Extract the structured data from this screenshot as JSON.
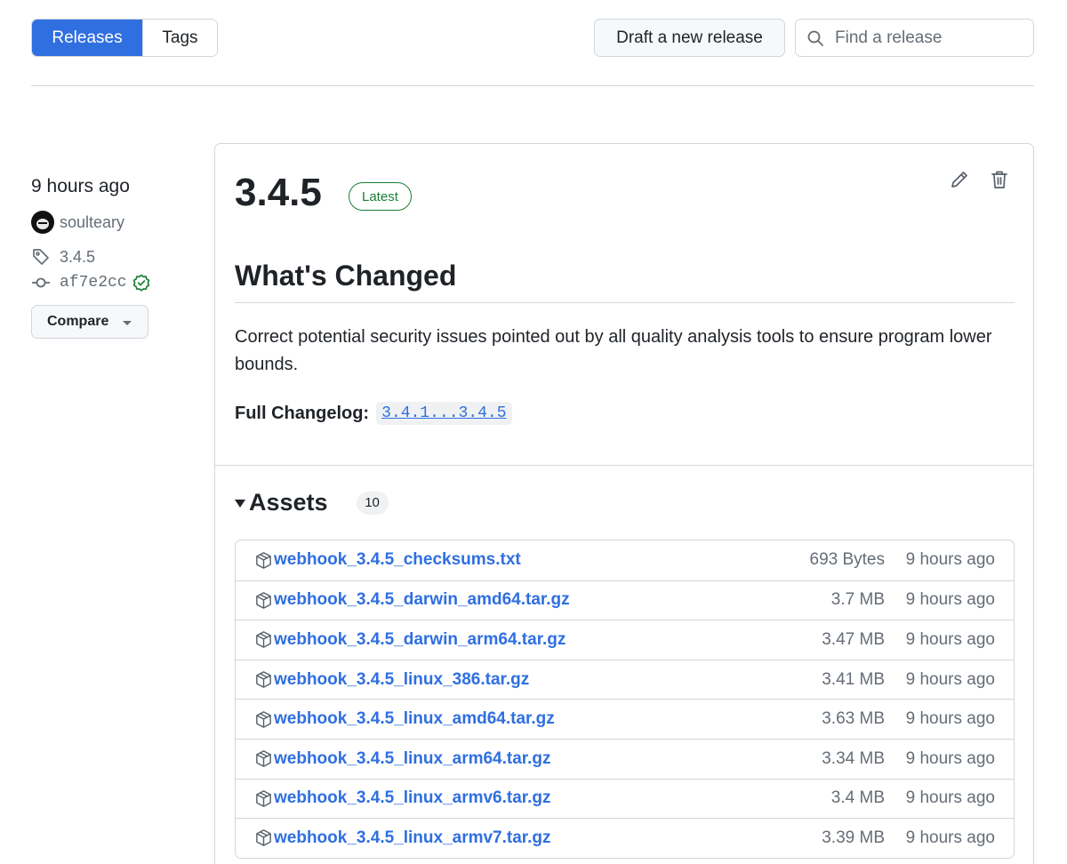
{
  "tabs": {
    "releases": "Releases",
    "tags": "Tags"
  },
  "actions": {
    "draft": "Draft a new release"
  },
  "search": {
    "placeholder": "Find a release"
  },
  "sidebar": {
    "time": "9 hours ago",
    "author": "soulteary",
    "tag": "3.4.5",
    "commit": "af7e2cc",
    "compare": "Compare"
  },
  "release": {
    "title": "3.4.5",
    "badge": "Latest",
    "heading": "What's Changed",
    "description": "Correct potential security issues pointed out by all quality analysis tools to ensure program lower bounds.",
    "changelog_label": "Full Changelog:",
    "changelog_link": "3.4.1...3.4.5"
  },
  "assets": {
    "title": "Assets",
    "count": "10",
    "items": [
      {
        "name": "webhook_3.4.5_checksums.txt",
        "size": "693 Bytes",
        "time": "9 hours ago"
      },
      {
        "name": "webhook_3.4.5_darwin_amd64.tar.gz",
        "size": "3.7 MB",
        "time": "9 hours ago"
      },
      {
        "name": "webhook_3.4.5_darwin_arm64.tar.gz",
        "size": "3.47 MB",
        "time": "9 hours ago"
      },
      {
        "name": "webhook_3.4.5_linux_386.tar.gz",
        "size": "3.41 MB",
        "time": "9 hours ago"
      },
      {
        "name": "webhook_3.4.5_linux_amd64.tar.gz",
        "size": "3.63 MB",
        "time": "9 hours ago"
      },
      {
        "name": "webhook_3.4.5_linux_arm64.tar.gz",
        "size": "3.34 MB",
        "time": "9 hours ago"
      },
      {
        "name": "webhook_3.4.5_linux_armv6.tar.gz",
        "size": "3.4 MB",
        "time": "9 hours ago"
      },
      {
        "name": "webhook_3.4.5_linux_armv7.tar.gz",
        "size": "3.39 MB",
        "time": "9 hours ago"
      }
    ]
  },
  "colors": {
    "accent": "#2f6fe0",
    "success": "#1a7f37",
    "border": "#d0d7de",
    "muted": "#656d76"
  }
}
